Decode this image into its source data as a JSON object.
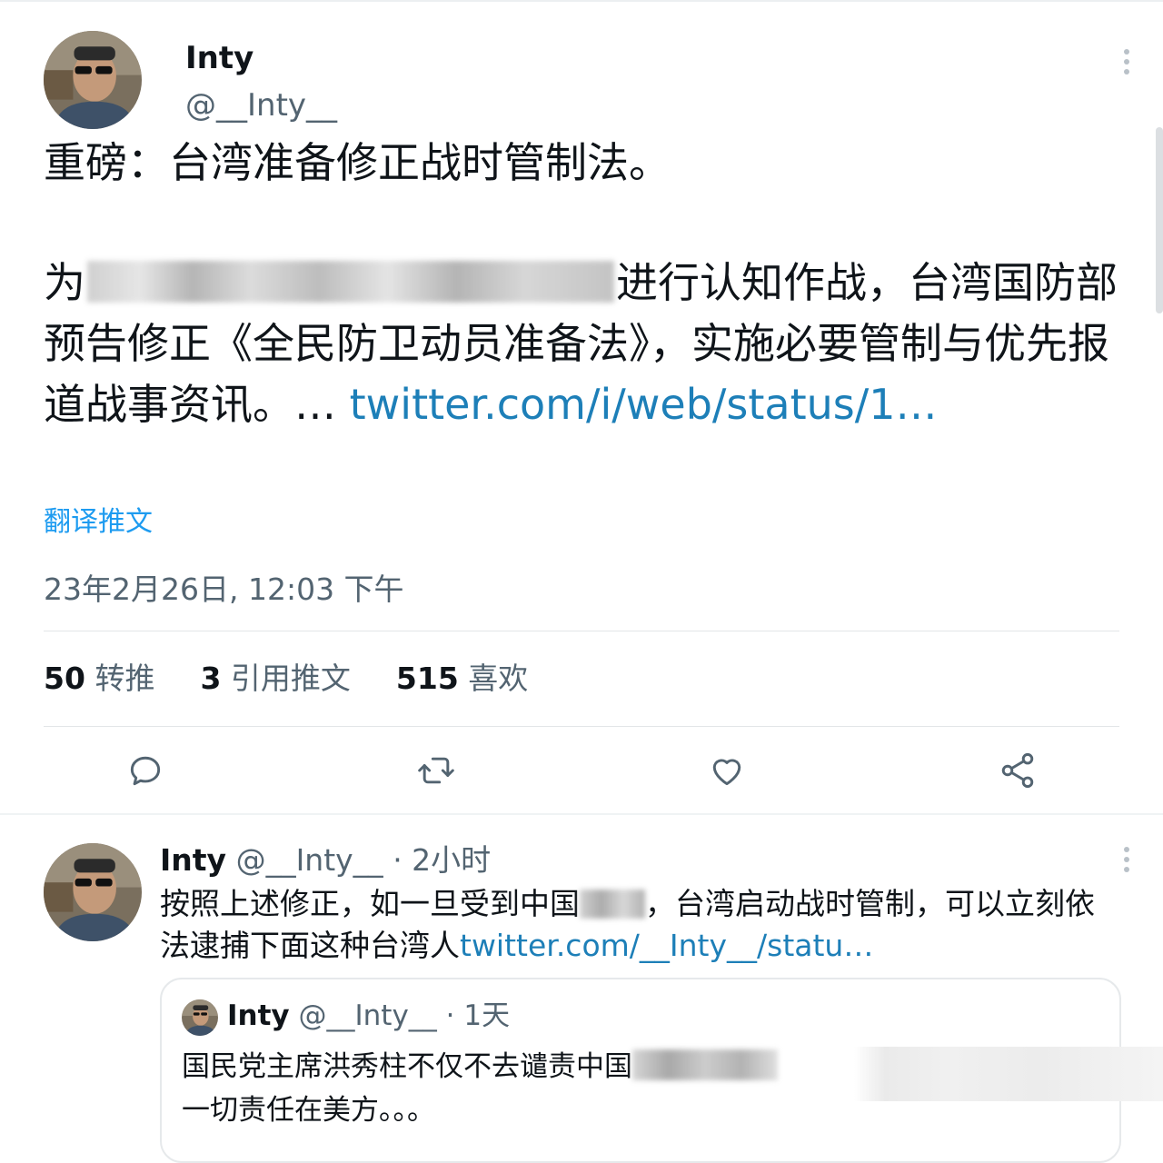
{
  "tweet": {
    "author_name": "Inty",
    "author_handle": "@__Inty__",
    "headline": "重磅：台湾准备修正战时管制法。",
    "body_prefix": "为",
    "body_after_blur": "进行认知作战，台湾国防部预告修正《全民防卫动员准备法》，实施必要管制与优先报道战事资讯。… ",
    "body_link": "twitter.com/i/web/status/1…",
    "translate_label": "翻译推文",
    "timestamp": "23年2月26日, 12:03 下午",
    "stats": [
      {
        "count": "50",
        "label": "转推"
      },
      {
        "count": "3",
        "label": "引用推文"
      },
      {
        "count": "515",
        "label": "喜欢"
      }
    ],
    "actions": [
      "reply-icon",
      "retweet-icon",
      "like-icon",
      "share-icon"
    ]
  },
  "reply": {
    "author_name": "Inty",
    "author_handle": "@__Inty__",
    "time": "· 2小时",
    "text_part1": "按照上述修正，如一旦受到中国",
    "text_part2": "，台湾启动战时管制，可以立刻依法逮捕下面这种台湾人",
    "link": "twitter.com/__Inty__/statu…"
  },
  "quote": {
    "author_name": "Inty",
    "author_handle": "@__Inty__",
    "time": "· 1天",
    "text_part1": "国民党主席洪秀柱不仅不去谴责中国",
    "text_part2": "一切责任在美方。。。"
  },
  "colors": {
    "link": "#1d9bf0",
    "secondary_text": "#536471",
    "primary_text": "#0f1419"
  }
}
